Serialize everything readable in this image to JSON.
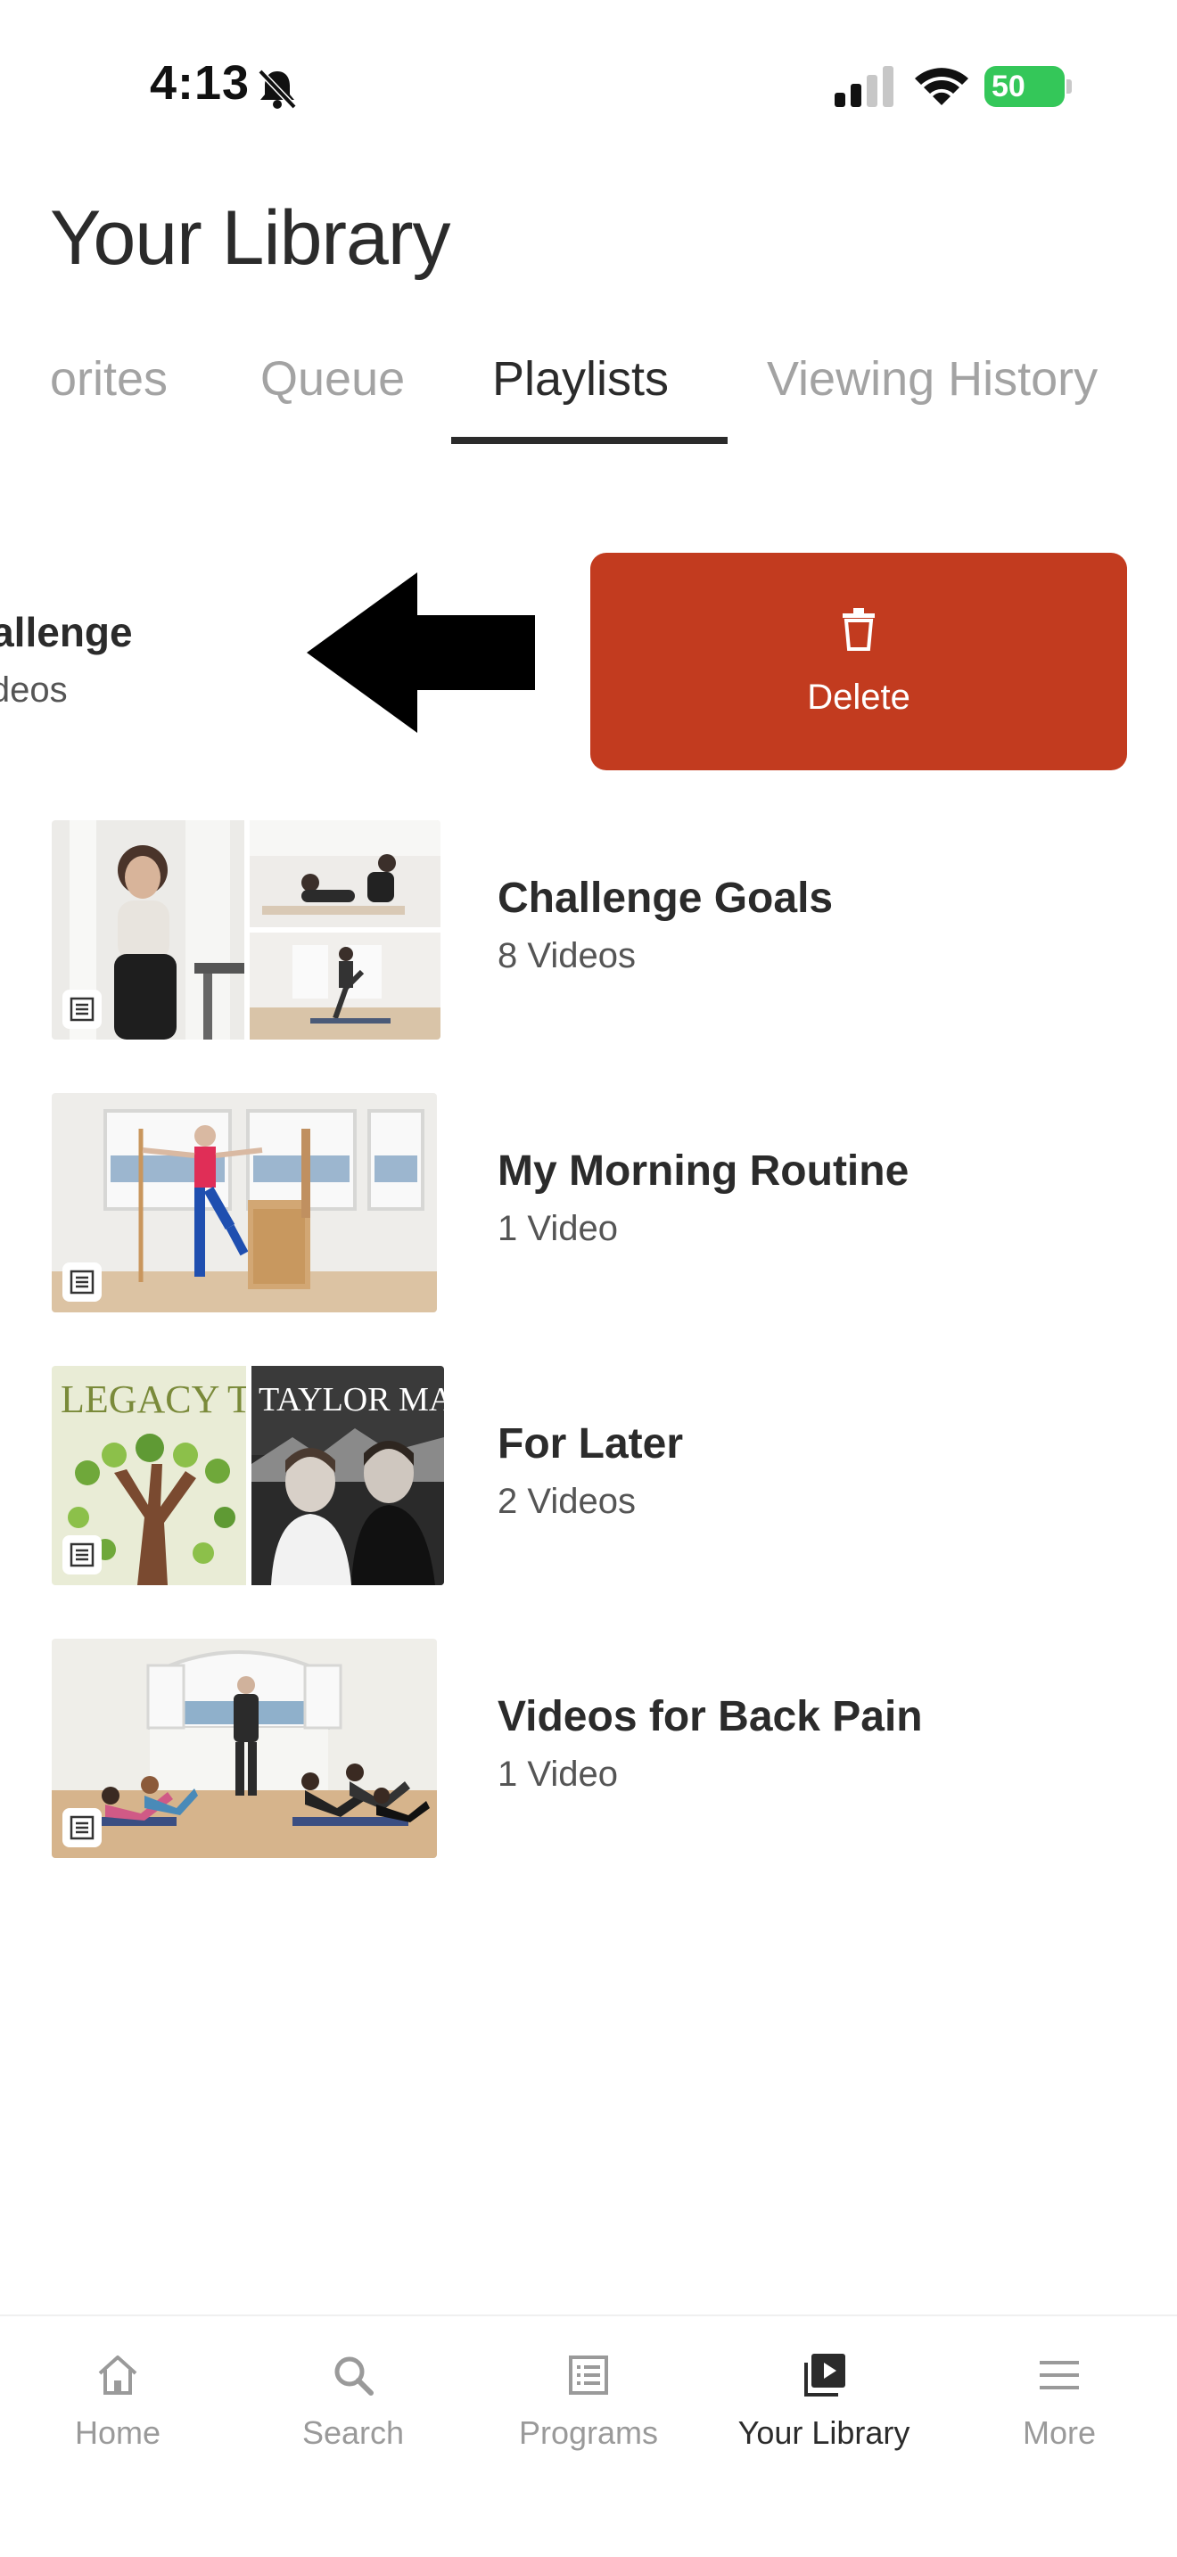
{
  "status_bar": {
    "time": "4:13",
    "battery": "50"
  },
  "header": {
    "title": "Your Library"
  },
  "tabs": [
    {
      "label": "orites"
    },
    {
      "label": "Queue"
    },
    {
      "label": "Playlists",
      "active": true
    },
    {
      "label": "Viewing History"
    }
  ],
  "swiped_row": {
    "title": "hallenge",
    "subtitle": "Videos",
    "action": {
      "label": "Delete",
      "color": "#c23b1f"
    }
  },
  "playlists": [
    {
      "title": "Challenge Goals",
      "count": "8 Videos"
    },
    {
      "title": "My Morning Routine",
      "count": "1 Video"
    },
    {
      "title": "For Later",
      "count": "2 Videos",
      "thumb_text_left": "LEGACY T",
      "thumb_text_right": "TAYLOR MADE"
    },
    {
      "title": "Videos for Back Pain",
      "count": "1 Video"
    }
  ],
  "bottom_nav": [
    {
      "label": "Home",
      "icon": "home-icon"
    },
    {
      "label": "Search",
      "icon": "search-icon"
    },
    {
      "label": "Programs",
      "icon": "programs-icon"
    },
    {
      "label": "Your Library",
      "icon": "library-icon",
      "active": true
    },
    {
      "label": "More",
      "icon": "menu-icon"
    }
  ]
}
